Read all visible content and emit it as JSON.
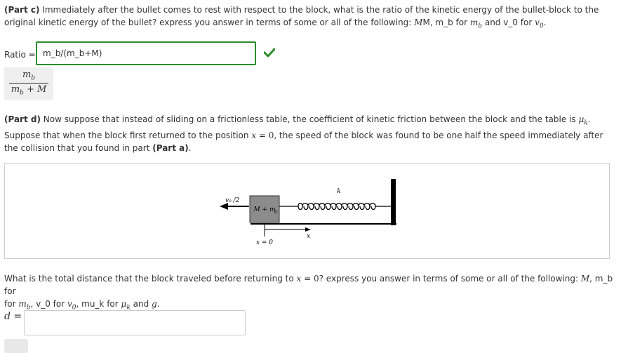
{
  "part_c": {
    "label": "(Part c)",
    "text": " Immediately after the bullet comes to rest with respect to the block, what is the ratio of the kinetic energy of the bullet-block to the original kinetic energy of the bullet? express you answer in terms of some or all of the following: ",
    "vars": "M, m_b for ",
    "m_b_sym": "mb",
    "and": " and v_0 for ",
    "v0_sym": "v0",
    "end": "."
  },
  "ratio": {
    "label": "Ratio =",
    "value": "m_b/(m_b+M)",
    "status": "correct",
    "status_icon": "check-icon",
    "status_color": "#2e8b2e",
    "preview_num": "m_b",
    "preview_den": "m_b + M"
  },
  "part_d": {
    "label": "(Part d)",
    "text1": " Now suppose that instead of sliding on a frictionless table, the coefficient of kinetic friction between the block and the table is ",
    "mu_sym": "μk",
    "text2": "Suppose that when the block first returned to the position ",
    "eq": "x = 0",
    "text3": ", the speed of the block was found to be one half the speed immediately after the collision that you found in part ",
    "part_ref": "(Part a)",
    "end": "."
  },
  "figure": {
    "velocity_label": "v0 /2",
    "block_label": "M + mb",
    "spring_label": "k",
    "x_label": "x",
    "origin_label": "x = 0"
  },
  "question": {
    "text1": "What is the total distance that the block traveled before returning to ",
    "eq": "x = 0",
    "text2": "? express you answer in terms of some or all of the following: ",
    "M": "M",
    "text3": ", m_b for ",
    "text4": ", v_0 for ",
    "text5": ", mu_k for ",
    "text6": " and ",
    "g": "g",
    "end": "."
  },
  "answer": {
    "label": "d =",
    "value": ""
  }
}
